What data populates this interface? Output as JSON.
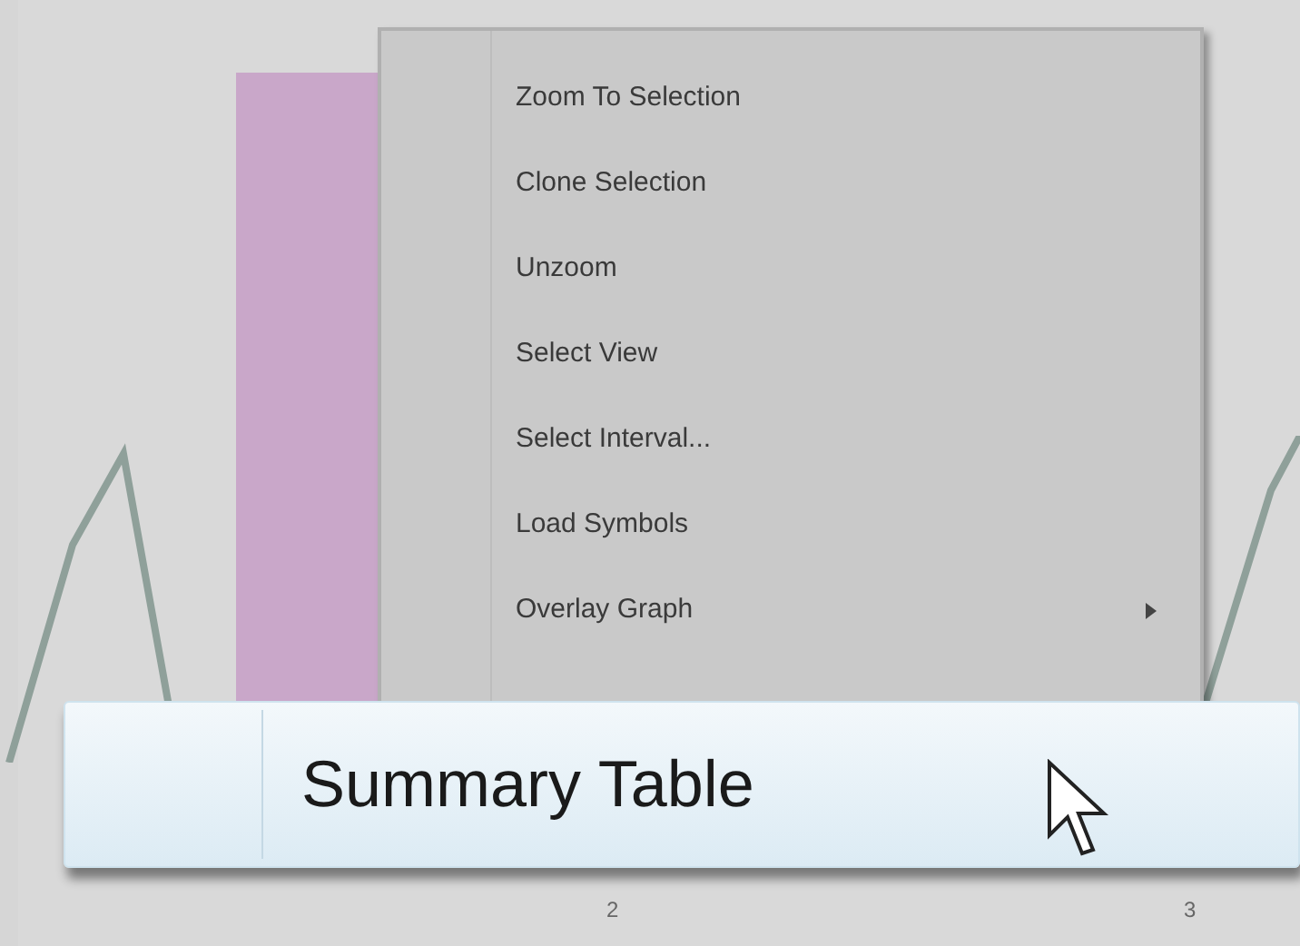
{
  "graph": {
    "x_tick_labels": [
      "2",
      "3"
    ]
  },
  "context_menu": {
    "items": [
      {
        "label": "Zoom To Selection",
        "has_submenu": false
      },
      {
        "label": "Clone Selection",
        "has_submenu": false
      },
      {
        "label": "Unzoom",
        "has_submenu": false
      },
      {
        "label": "Select View",
        "has_submenu": false
      },
      {
        "label": "Select Interval...",
        "has_submenu": false
      },
      {
        "label": "Load Symbols",
        "has_submenu": false
      },
      {
        "label": "Overlay Graph",
        "has_submenu": true
      }
    ]
  },
  "magnified_item": {
    "label": "Summary Table",
    "selected": true
  }
}
